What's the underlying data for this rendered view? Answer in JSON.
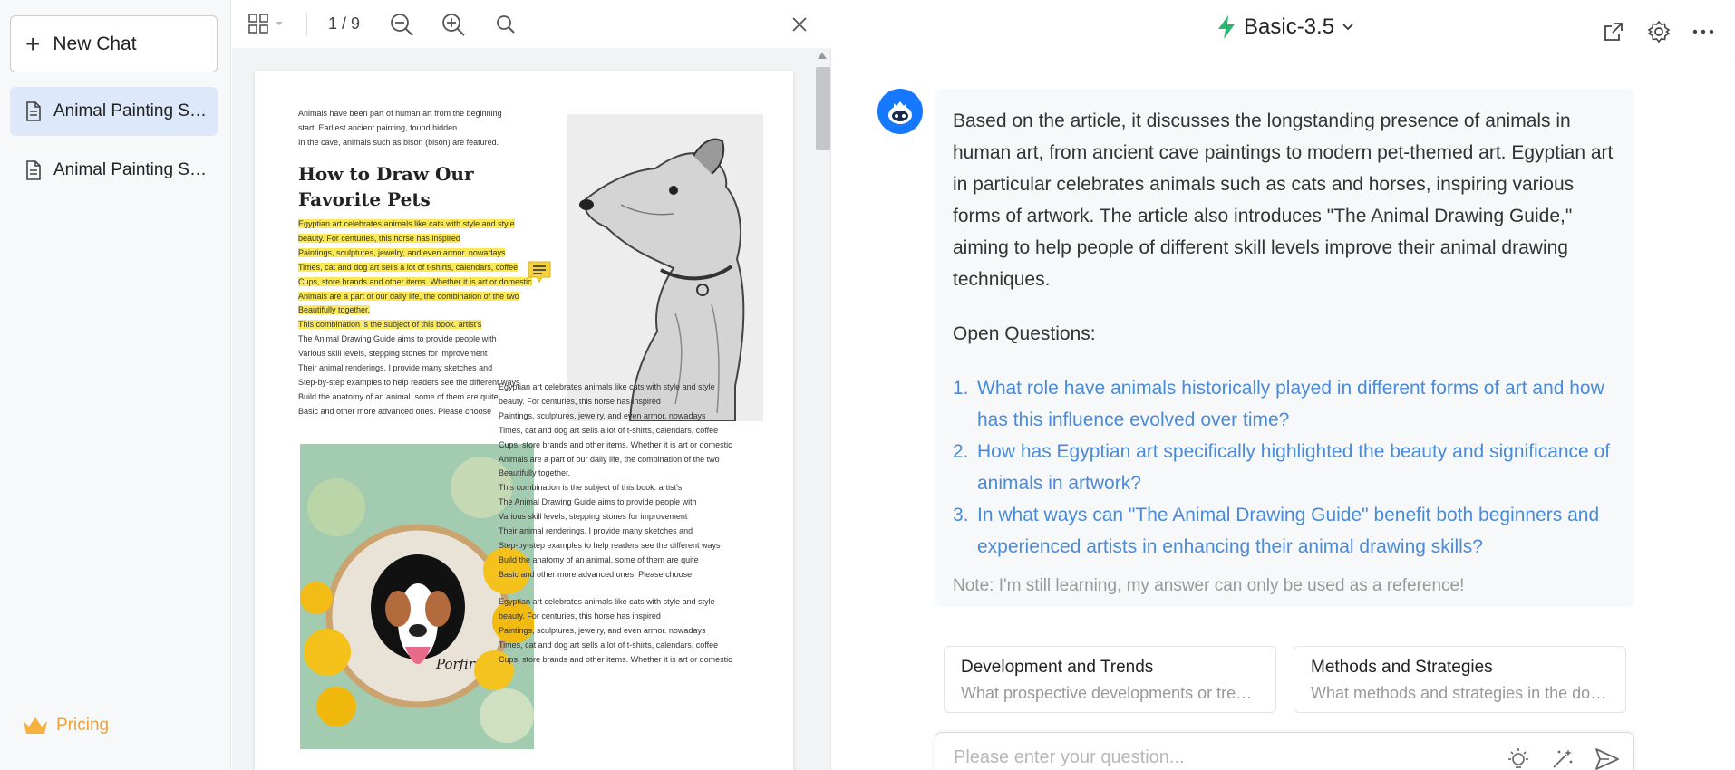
{
  "sidebar": {
    "new_chat_label": "New Chat",
    "documents": [
      {
        "title": "Animal Painting Skills"
      },
      {
        "title": "Animal Painting Skills"
      }
    ],
    "pricing_label": "Pricing"
  },
  "viewer": {
    "page_counter": "1 / 9",
    "pdf": {
      "intro_lines": [
        "Animals have been part of human art from the beginning",
        "start. Earliest ancient painting, found hidden",
        "In the cave, animals such as bison (bison) are featured."
      ],
      "title_line1": "How to Draw Our",
      "title_line2": "Favorite Pets",
      "highlighted_lines": [
        "Egyptian art celebrates animals like cats with style and style",
        "beauty. For centuries, this horse has inspired",
        "Paintings, sculptures, jewelry, and even armor. nowadays",
        "Times, cat and dog art sells a lot of t-shirts, calendars, coffee",
        "Cups, store brands and other items. Whether it is art or domestic",
        "Animals are a part of our daily life, the combination of the two",
        "Beautifully together.",
        "This combination is the subject of this book. artist's"
      ],
      "body_lines": [
        "The Animal Drawing Guide aims to provide people with",
        "Various skill levels, stepping stones for improvement",
        "Their animal renderings. I provide many sketches and",
        "Step-by-step examples to help readers see the different ways",
        "Build the anatomy of an animal. some of them are quite",
        "Basic and other more advanced ones. Please choose"
      ],
      "right_col_lines": [
        "Egyptian art celebrates animals like cats with style and style",
        "beauty. For centuries, this horse has inspired",
        "Paintings, sculptures, jewelry, and even armor. nowadays",
        "Times, cat and dog art sells a lot of t-shirts, calendars, coffee",
        "Cups, store brands and other items. Whether it is art or domestic",
        "Animals are a part of our daily life, the combination of the two",
        "Beautifully together.",
        "This combination is the subject of this book. artist's",
        "The Animal Drawing Guide aims to provide people with",
        "Various skill levels, stepping stones for improvement",
        "Their animal renderings. I provide many sketches and",
        "Step-by-step examples to help readers see the different ways",
        "Build the anatomy of an animal. some of them are quite",
        "Basic and other more advanced ones. Please choose"
      ],
      "right_col_lines_2": [
        "Egyptian art celebrates animals like cats with style and style",
        "beauty. For centuries, this horse has inspired",
        "Paintings, sculptures, jewelry, and even armor. nowadays",
        "Times, cat and dog art sells a lot of t-shirts, calendars, coffee",
        "Cups, store brands and other items. Whether it is art or domestic"
      ],
      "embroidery_text": "Porfirio"
    }
  },
  "chat": {
    "model_name": "Basic-3.5",
    "answer_text": "Based on the article, it discusses the longstanding presence of animals in human art, from ancient cave paintings to modern pet-themed art. Egyptian art in particular celebrates animals such as cats and horses, inspiring various forms of artwork. The article also introduces \"The Animal Drawing Guide,\" aiming to help people of different skill levels improve their animal drawing techniques.",
    "open_questions_title": "Open Questions:",
    "open_questions": [
      {
        "num": "1.",
        "text": "What role have animals historically played in different forms of art and how has this influence evolved over time?"
      },
      {
        "num": "2.",
        "text": "How has Egyptian art specifically highlighted the beauty and significance of animals in artwork?"
      },
      {
        "num": "3.",
        "text": "In what ways can \"The Animal Drawing Guide\" benefit both beginners and experienced artists in enhancing their animal drawing skills?"
      }
    ],
    "note": "Note: I'm still learning, my answer can only be used as a reference!",
    "suggestions": [
      {
        "title": "Development and Trends",
        "desc": "What prospective developments or trends are discussed in the document?"
      },
      {
        "title": "Methods and Strategies",
        "desc": "What methods and strategies in the document are proposed?"
      }
    ],
    "input_placeholder": "Please enter your question..."
  },
  "colors": {
    "accent": "#1677ff",
    "active_item_bg": "#dde9fb",
    "link": "#4a8bd8",
    "pricing": "#f0a132",
    "highlight": "#fbe95a",
    "model_icon": "#2bb673"
  }
}
